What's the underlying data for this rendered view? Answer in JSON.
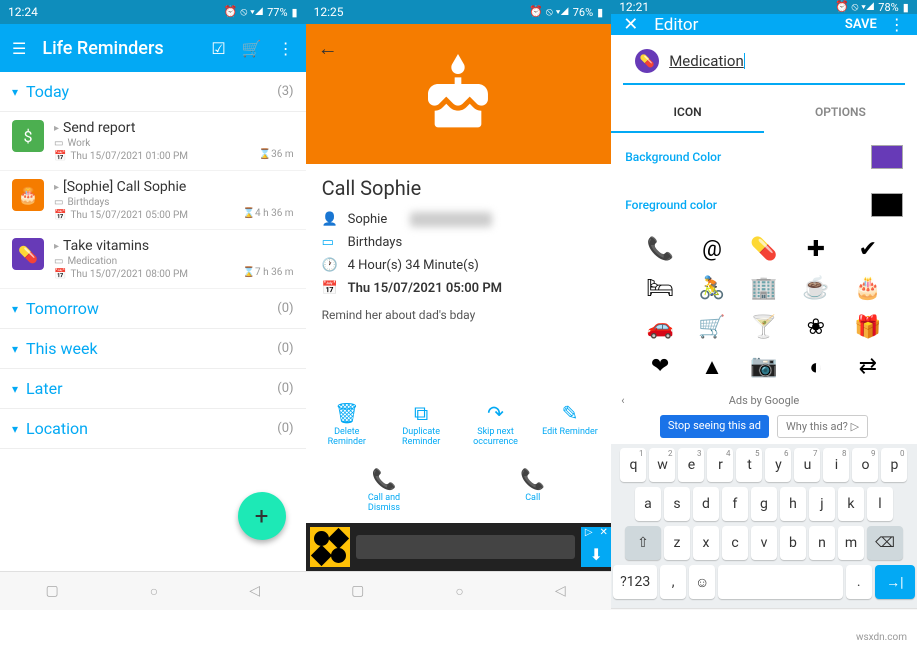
{
  "watermark": "wsxdn.com",
  "screen1": {
    "status": {
      "time": "12:24",
      "battery": "77%"
    },
    "appTitle": "Life Reminders",
    "sections": {
      "today": {
        "label": "Today",
        "count": "(3)"
      },
      "tomorrow": {
        "label": "Tomorrow",
        "count": "(0)"
      },
      "thisWeek": {
        "label": "This week",
        "count": "(0)"
      },
      "later": {
        "label": "Later",
        "count": "(0)"
      },
      "location": {
        "label": "Location",
        "count": "(0)"
      }
    },
    "items": {
      "r1": {
        "title": "Send report",
        "category": "Work",
        "datetime": "Thu 15/07/2021 01:00 PM",
        "remaining": "36 m",
        "iconColor": "#4CAF50",
        "iconGlyph": "$"
      },
      "r2": {
        "title": "[Sophie] Call Sophie",
        "category": "Birthdays",
        "datetime": "Thu 15/07/2021 05:00 PM",
        "remaining": "4 h 36 m",
        "iconColor": "#F57C00",
        "iconGlyph": "🎂"
      },
      "r3": {
        "title": "Take vitamins",
        "category": "Medication",
        "datetime": "Thu 15/07/2021 08:00 PM",
        "remaining": "7 h 36 m",
        "iconColor": "#673AB7",
        "iconGlyph": "💊"
      }
    }
  },
  "screen2": {
    "status": {
      "time": "12:25",
      "battery": "76%"
    },
    "title": "Call Sophie",
    "contactLabel": "Sophie",
    "category": "Birthdays",
    "duration": "4 Hour(s) 34 Minute(s)",
    "datetime": "Thu 15/07/2021 05:00 PM",
    "note": "Remind her about dad's bday",
    "actions": {
      "delete": "Delete Reminder",
      "duplicate": "Duplicate Reminder",
      "skip": "Skip next occurrence",
      "edit": "Edit Reminder",
      "callDismiss": "Call and Dismiss",
      "call": "Call"
    }
  },
  "screen3": {
    "status": {
      "time": "12:21",
      "battery": "78%"
    },
    "barTitle": "Editor",
    "save": "SAVE",
    "inputValue": "Medication",
    "tabs": {
      "icon": "ICON",
      "options": "OPTIONS"
    },
    "bgColorLabel": "Background Color",
    "fgColorLabel": "Foreground color",
    "bgColor": "#673AB7",
    "fgColor": "#000000",
    "adsBy": "Ads by Google",
    "stopAd": "Stop seeing this ad",
    "whyAd": "Why this ad? ▷",
    "icons": [
      "📞",
      "@",
      "💊",
      "✚",
      "✔",
      "🛏",
      "🚴",
      "🏢",
      "☕",
      "🎂",
      "🚗",
      "🛒",
      "🍸",
      "❀",
      "🎁",
      "❤",
      "▲",
      "📷",
      "◐",
      "⇄"
    ],
    "keyboard": {
      "row1": [
        [
          "q",
          "1"
        ],
        [
          "w",
          "2"
        ],
        [
          "e",
          "3"
        ],
        [
          "r",
          "4"
        ],
        [
          "t",
          "5"
        ],
        [
          "y",
          "6"
        ],
        [
          "u",
          "7"
        ],
        [
          "i",
          "8"
        ],
        [
          "o",
          "9"
        ],
        [
          "p",
          "0"
        ]
      ],
      "row2": [
        "a",
        "s",
        "d",
        "f",
        "g",
        "h",
        "j",
        "k",
        "l"
      ],
      "row3": [
        "z",
        "x",
        "c",
        "v",
        "b",
        "n",
        "m"
      ],
      "numKey": "?123",
      "comma": ",",
      "emoji": "☺",
      "period": "."
    }
  }
}
